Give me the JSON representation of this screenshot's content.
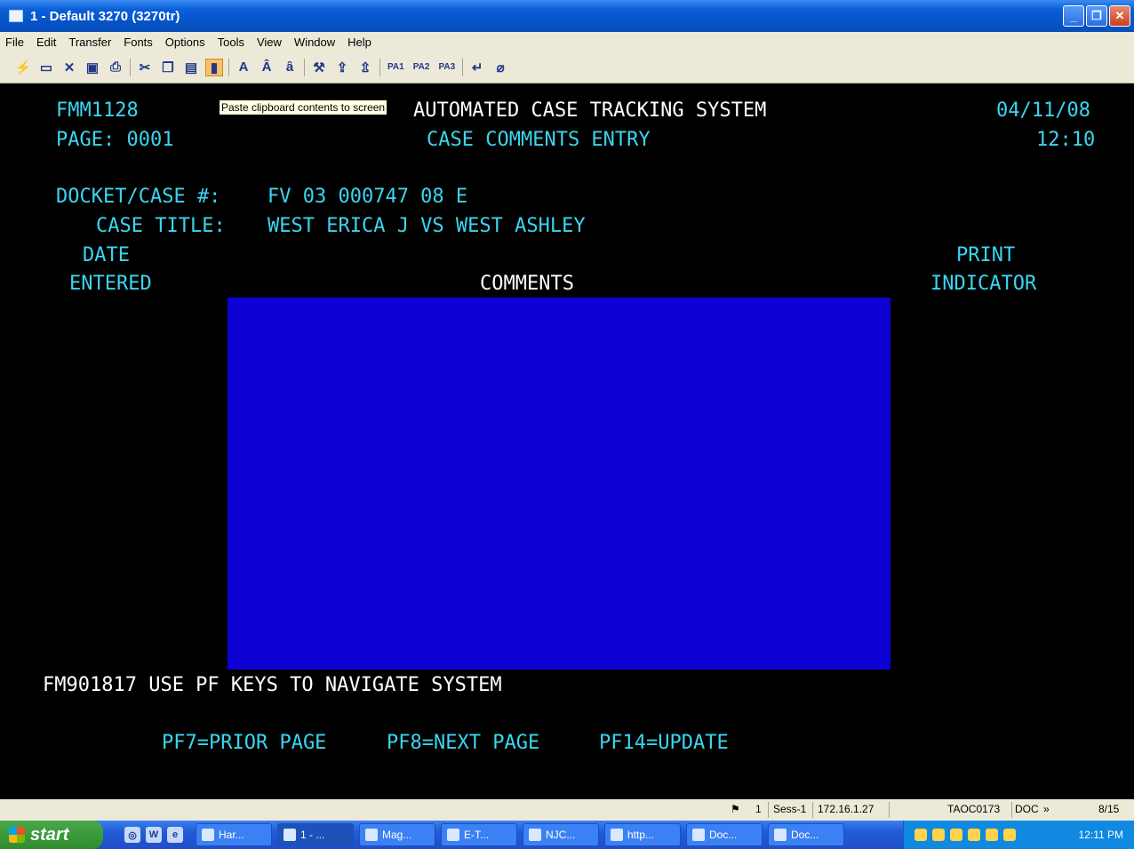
{
  "window": {
    "title": "1 - Default 3270 (3270tr)",
    "minimize_label": "_",
    "restore_label": "❐",
    "close_label": "✕"
  },
  "menu": [
    "File",
    "Edit",
    "Transfer",
    "Fonts",
    "Options",
    "Tools",
    "View",
    "Window",
    "Help"
  ],
  "toolbar": {
    "pa1": "PA1",
    "pa2": "PA2",
    "pa3": "PA3",
    "tooltip": "Paste clipboard contents to screen"
  },
  "screen": {
    "program_id": "FMM1128",
    "system_title": "AUTOMATED CASE TRACKING SYSTEM",
    "date": "04/11/08",
    "page_label": "PAGE: 0001",
    "screen_title": "CASE COMMENTS ENTRY",
    "time": "12:10",
    "docket_label": "DOCKET/CASE #:",
    "docket_value": "FV 03 000747 08 E",
    "case_title_label": "CASE TITLE:",
    "case_title_value": "WEST ERICA J VS WEST ASHLEY",
    "col_date_1": "DATE",
    "col_date_2": "ENTERED",
    "col_comments": "COMMENTS",
    "col_print_1": "PRINT",
    "col_print_2": "INDICATOR",
    "message": "FM901817 USE PF KEYS TO NAVIGATE SYSTEM",
    "pf7": "PF7=PRIOR PAGE",
    "pf8": "PF8=NEXT PAGE",
    "pf14": "PF14=UPDATE"
  },
  "statusbar": {
    "session_num": "1",
    "session": "Sess-1",
    "ip": "172.16.1.27",
    "host": "TAOC0173",
    "mode": "DOC",
    "more": "»",
    "cursor": "8/15"
  },
  "taskbar": {
    "start_label": "start",
    "tasks": [
      "Har...",
      "1 - ...",
      "Mag...",
      "E-T...",
      "NJC...",
      "http...",
      "Doc...",
      "Doc..."
    ],
    "clock": "12:11 PM"
  }
}
